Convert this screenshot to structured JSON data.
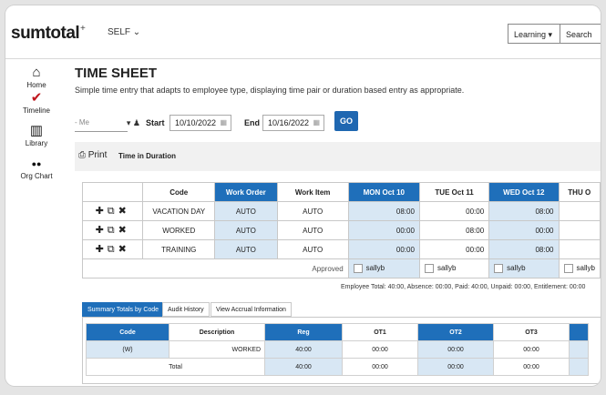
{
  "brand": {
    "logo": "sumtotal",
    "logo_mark": "+"
  },
  "topbar": {
    "self": "SELF ⌄",
    "learning": "Learning ▾",
    "search": "Search"
  },
  "sidenav": [
    {
      "label": "Home",
      "icon": "home-icon",
      "glyph": "⌂"
    },
    {
      "label": "Timeline",
      "icon": "timeline-icon",
      "glyph": "✔"
    },
    {
      "label": "Library",
      "icon": "library-icon",
      "glyph": "▥"
    },
    {
      "label": "Org Chart",
      "icon": "org-chart-icon",
      "glyph": "●●"
    }
  ],
  "page": {
    "title": "TIME SHEET",
    "subtitle": "Simple time entry that adapts to employee type, displaying time pair or duration based entry as appropriate."
  },
  "filters": {
    "me": "- Me",
    "start_label": "Start",
    "start_value": "10/10/2022",
    "end_label": "End",
    "end_value": "10/16/2022",
    "go": "GO"
  },
  "printbar": {
    "print": "Print",
    "time_in_duration": "Time in Duration"
  },
  "timesheet": {
    "headers": [
      "Code",
      "Work Order",
      "Work Item",
      "MON Oct 10",
      "TUE Oct 11",
      "WED Oct 12",
      "THU O"
    ],
    "rows": [
      {
        "code": "VACATION DAY",
        "work_order": "AUTO",
        "work_item": "AUTO",
        "mon": "08:00",
        "tue": "00:00",
        "wed": "08:00"
      },
      {
        "code": "WORKED",
        "work_order": "AUTO",
        "work_item": "AUTO",
        "mon": "00:00",
        "tue": "08:00",
        "wed": "00:00"
      },
      {
        "code": "TRAINING",
        "work_order": "AUTO",
        "work_item": "AUTO",
        "mon": "00:00",
        "tue": "00:00",
        "wed": "08:00"
      }
    ],
    "approved_label": "Approved",
    "approvers": [
      "sallyb",
      "sallyb",
      "sallyb",
      "sallyb"
    ]
  },
  "employee_totals": "Employee Total: 40:00, Absence: 00:00, Paid: 40:00, Unpaid: 00:00, Entitlement: 00:00",
  "tabs": [
    "Summary Totals by Code",
    "Audit History",
    "View Accrual Information"
  ],
  "summary": {
    "headers": [
      "Code",
      "Description",
      "Reg",
      "OT1",
      "OT2",
      "OT3"
    ],
    "rows": [
      {
        "code": "(W)",
        "description": "WORKED",
        "reg": "40:00",
        "ot1": "00:00",
        "ot2": "00:00",
        "ot3": "00:00"
      }
    ],
    "total_label": "Total",
    "total": {
      "reg": "40:00",
      "ot1": "00:00",
      "ot2": "00:00",
      "ot3": "00:00"
    }
  },
  "colors": {
    "accent": "#1f6fba",
    "cell_highlight": "#d8e7f4"
  }
}
